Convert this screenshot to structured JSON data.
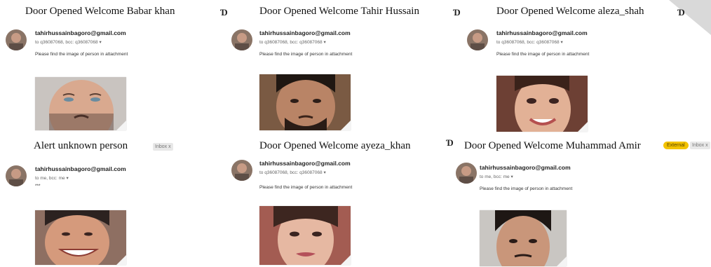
{
  "panels": [
    {
      "subject": "Door Opened Welcome Babar khan",
      "sender": "tahirhussainbagoro@gmail.com",
      "recipients": "to q36087068, bcc: q36087068",
      "message": "Please find the image of person in attachment",
      "person": "man with beard, light skin",
      "skin": "#d9a98f",
      "hair": "#3b2a22",
      "bg": "#c9c4c0"
    },
    {
      "subject": "Door Opened Welcome Tahir Hussain",
      "sender": "tahirhussainbagoro@gmail.com",
      "recipients": "to q36087068, bcc: q36087068",
      "message": "Please find the image of person in attachment",
      "person": "man with dark hair and beard",
      "skin": "#b98466",
      "hair": "#1f1712",
      "bg": "#7a5a43"
    },
    {
      "subject": "Door Opened Welcome aleza_shah",
      "sender": "tahirhussainbagoro@gmail.com",
      "recipients": "to q36087068, bcc: q36087068",
      "message": "Please find the image of person in attachment",
      "person": "smiling woman",
      "skin": "#e2b196",
      "hair": "#3a221a",
      "bg": "#6d4034"
    },
    {
      "subject": "Alert unknown person",
      "chip": "Inbox x",
      "sender": "tahirhussainbagoro@gmail.com",
      "recipients": "to me, bcc: me",
      "message": "***",
      "person": "smiling man",
      "skin": "#d59a7c",
      "hair": "#2c2220",
      "bg": "#8e6f62"
    },
    {
      "subject": "Door Opened Welcome ayeza_khan",
      "sender": "tahirhussainbagoro@gmail.com",
      "recipients": "to q36087068, bcc: q36087068",
      "message": "Please find the image of person in attachment",
      "person": "woman with makeup",
      "skin": "#e6b8a2",
      "hair": "#3d2620",
      "bg": "#a35c52"
    },
    {
      "subject": "Door Opened Welcome Muhammad Amir",
      "chip_external": "External",
      "chip": "Inbox x",
      "sender": "tahirhussainbagoro@gmail.com",
      "recipients": "to me, bcc: me",
      "message": "Please find the image of person in attachment",
      "person": "young man with dark hair",
      "skin": "#c9967a",
      "hair": "#1e1714",
      "bg": "#c9c6c2"
    }
  ],
  "label_glyph": "Ɗ",
  "dropdown_glyph": "▾",
  "watermark_color": "#d9d9d9"
}
